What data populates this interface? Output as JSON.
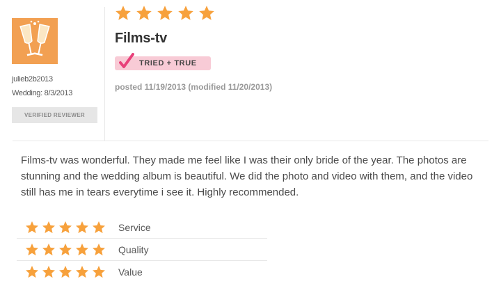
{
  "reviewer": {
    "username": "julieb2b2013",
    "wedding_line": "Wedding: 8/3/2013",
    "badge": "VERIFIED REVIEWER",
    "avatar_icon": "champagne-glasses-icon"
  },
  "review": {
    "overall_rating": 5,
    "max_rating": 5,
    "vendor_name": "Films-tv",
    "badge": "TRIED + TRUE",
    "posted": "posted 11/19/2013 (modified 11/20/2013)",
    "body": "Films-tv was wonderful. They made me feel like I was their only bride of the year. The photos are stunning and the wedding album is beautiful. We did the photo and video with them, and the video still has me in tears everytime i see it. Highly recommended."
  },
  "ratings": [
    {
      "label": "Service",
      "stars": 5
    },
    {
      "label": "Quality",
      "stars": 5
    },
    {
      "label": "Value",
      "stars": 5
    }
  ],
  "colors": {
    "star": "#f7a13c",
    "avatar_bg": "#f2a052",
    "badge_pink": "#f8cbd6",
    "check_pink": "#e8417a",
    "verified_bg": "#e6e6e6"
  }
}
